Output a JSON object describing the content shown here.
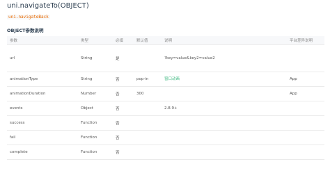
{
  "page": {
    "title": "uni.navigateTo(OBJECT)",
    "code_token": "uni.navigateBack",
    "section_title": "OBJECT参数说明"
  },
  "table": {
    "headers": {
      "param": "参数",
      "type": "类型",
      "required": "必填",
      "default": "默认值",
      "note": "说明",
      "platform": "平台差异说明"
    },
    "rows": [
      {
        "param": "url",
        "type": "String",
        "required": "是",
        "default": "",
        "note_lines": [
          "?key=value&key2=value2"
        ],
        "platform": ""
      },
      {
        "param": "animationType",
        "type": "String",
        "required": "否",
        "default": "pop-in",
        "note_link": "窗口动画",
        "platform": "App"
      },
      {
        "param": "animationDuration",
        "type": "Number",
        "required": "否",
        "default": "300",
        "note": "",
        "platform": "App"
      },
      {
        "param": "events",
        "type": "Object",
        "required": "否",
        "default": "",
        "note": "2.8.9+",
        "platform": ""
      },
      {
        "param": "success",
        "type": "Function",
        "required": "否",
        "default": "",
        "note": "",
        "platform": ""
      },
      {
        "param": "fail",
        "type": "Function",
        "required": "否",
        "default": "",
        "note": "",
        "platform": ""
      },
      {
        "param": "complete",
        "type": "Function",
        "required": "否",
        "default": "",
        "note": "",
        "platform": ""
      }
    ]
  }
}
